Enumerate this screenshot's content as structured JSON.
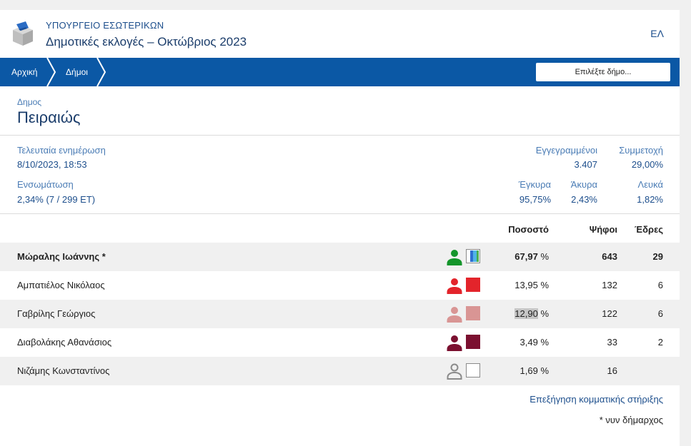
{
  "header": {
    "ministry": "ΥΠΟΥΡΓΕΙΟ ΕΣΩΤΕΡΙΚΩΝ",
    "title": "Δημοτικές εκλογές – Οκτώβριος 2023",
    "language": "ΕΛ",
    "logo_icon": "ballot-box-icon"
  },
  "nav": {
    "breadcrumbs": [
      "Αρχική",
      "Δήμοι"
    ],
    "select_placeholder": "Επιλέξτε δήμο..."
  },
  "municipality": {
    "label": "Δημος",
    "name": "Πειραιώς"
  },
  "stats": {
    "last_update_label": "Τελευταία ενημέρωση",
    "last_update_value": "8/10/2023, 18:53",
    "integration_label": "Ενσωμάτωση",
    "integration_value": "2,34% (7 / 299 ΕΤ)",
    "registered_label": "Εγγεγραμμένοι",
    "registered_value": "3.407",
    "turnout_label": "Συμμετοχή",
    "turnout_value": "29,00%",
    "valid_label": "Έγκυρα",
    "valid_value": "95,75%",
    "invalid_label": "Άκυρα",
    "invalid_value": "2,43%",
    "blank_label": "Λευκά",
    "blank_value": "1,82%"
  },
  "table": {
    "headers": {
      "percent": "Ποσοστό",
      "votes": "Ψήφοι",
      "seats": "Έδρες"
    },
    "rows": [
      {
        "name": "Μώραλης Ιωάννης *",
        "percent": "67,97",
        "votes": "643",
        "seats": "29",
        "color": "#14952b",
        "party_icon": "party-flag-blue-green-icon"
      },
      {
        "name": "Αμπατιέλος Νικόλαος",
        "percent": "13,95",
        "votes": "132",
        "seats": "6",
        "color": "#e3242b",
        "party_icon": "party-square-red-icon"
      },
      {
        "name": "Γαβρίλης Γεώργιος",
        "percent": "12,90",
        "votes": "122",
        "seats": "6",
        "color": "#d99594",
        "party_icon": "party-square-pink-icon"
      },
      {
        "name": "Διαβολάκης Αθανάσιος",
        "percent": "3,49",
        "votes": "33",
        "seats": "2",
        "color": "#7b1030",
        "party_icon": "party-square-maroon-icon"
      },
      {
        "name": "Νιζάμης Κωνσταντίνος",
        "percent": "1,69",
        "votes": "16",
        "seats": "",
        "color": "#8a8a8a",
        "party_icon": "party-square-empty-icon"
      }
    ],
    "percent_sign": "%"
  },
  "footer": {
    "explanation_link": "Επεξήγηση κομματικής στήριξης",
    "footnote": "* νυν δήμαρχος"
  },
  "colors": {
    "nav_blue": "#0b58a5",
    "title_blue": "#1b3d6b",
    "link_blue": "#1c4e8c"
  }
}
